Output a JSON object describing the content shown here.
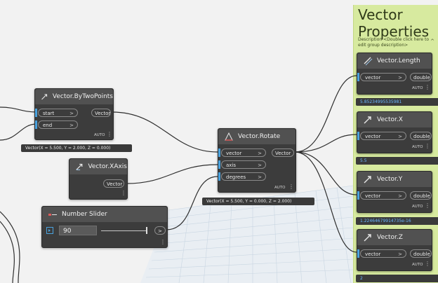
{
  "group": {
    "title": "Vector Properties",
    "description": "Description <Double click here to edit group description>",
    "collapse_glyph": "^"
  },
  "nodes": {
    "by_two_points": {
      "title": "Vector.ByTwoPoints",
      "inputs": [
        "start",
        "end"
      ],
      "output": "Vector",
      "lacing": "AUTO",
      "preview": "Vector(X = 5.500, Y = 2.000, Z = 0.000)"
    },
    "x_axis": {
      "title": "Vector.XAxis",
      "output": "Vector"
    },
    "number_slider": {
      "title": "Number Slider",
      "value": "90",
      "output_glyph": ">"
    },
    "rotate": {
      "title": "Vector.Rotate",
      "inputs": [
        "vector",
        "axis",
        "degrees"
      ],
      "output": "Vector",
      "lacing": "AUTO",
      "preview": "Vector(X = 5.500, Y = 0.000, Z = 2.000)"
    },
    "length": {
      "title": "Vector.Length",
      "input": "vector",
      "output": "double",
      "lacing": "AUTO",
      "preview": "5.85234995535981"
    },
    "vx": {
      "title": "Vector.X",
      "input": "vector",
      "output": "double",
      "lacing": "AUTO",
      "preview": "5.5"
    },
    "vy": {
      "title": "Vector.Y",
      "input": "vector",
      "output": "double",
      "lacing": "AUTO",
      "preview": "1.22464679914735e-16"
    },
    "vz": {
      "title": "Vector.Z",
      "input": "vector",
      "output": "double",
      "lacing": "AUTO",
      "preview": "2"
    }
  },
  "glyphs": {
    "arrow": ">",
    "dots": "⋮"
  },
  "colors": {
    "node_body": "#3c3c3c",
    "node_header": "#515151",
    "group_fill": "#d7ea9f",
    "port_marker": "#4aa3df",
    "wire": "#2e2e2e",
    "preview_blue": "#6bb7ff"
  },
  "icons": {
    "by_two_points": "diagonal-arrow-icon",
    "x_axis": "axis-arrow-icon",
    "rotate": "rotate-vector-icon",
    "slider": "slider-icon",
    "length": "ruler-icon",
    "component": "vector-component-icon"
  }
}
